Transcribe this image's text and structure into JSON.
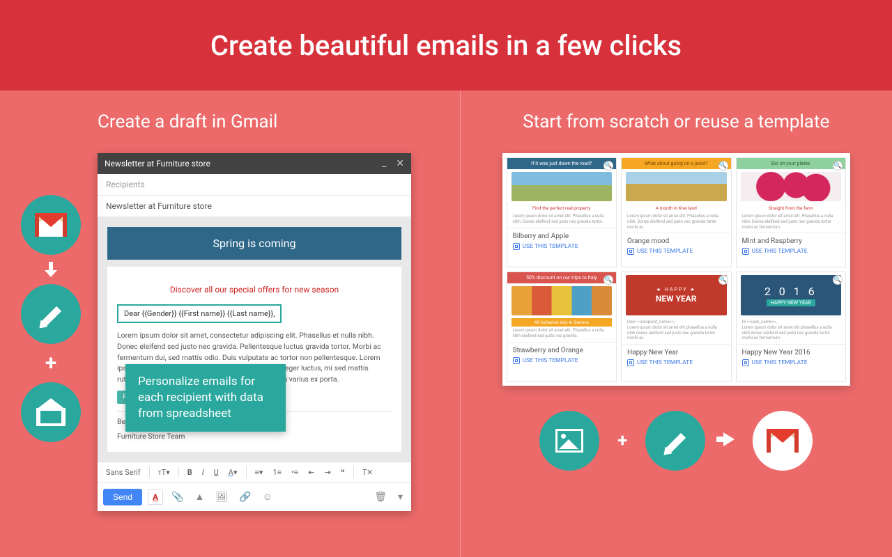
{
  "header": {
    "title": "Create beautiful emails in a few clicks"
  },
  "left_panel": {
    "title": "Create a draft in Gmail",
    "compose": {
      "window_title": "Newsletter at Furniture store",
      "recipients_placeholder": "Recipients",
      "subject": "Newsletter at Furniture store",
      "banner": "Spring is coming",
      "special_line": "Discover all our special offers for new season",
      "greeting": "Dear {{Gender}} {{First name}} {{Last name}},",
      "lorem": "Lorem ipsum dolor sit amet, consectetur adipiscing elit. Phasellus et nulla nibh. Donec eleifend sed justo nec gravida. Pellentesque luctus gravida tortor. Morbi ac fermentum dui, sed mattis odio. Duis vulputate ac tortor non pellentesque. Lorem ipsum dolor sit amet, consectetur adipiscing elit. Integer luctus, mi sed mattis rutrum, risus magna commodo eros et leo iaculis, eu varius ex porta.",
      "read_more": "Read more",
      "sign1": "Best regards,",
      "sign2": "Furniture Store Team",
      "font_label": "Sans Serif",
      "send_label": "Send"
    },
    "callout": "Personalize emails for each recipient with data from spreadsheet"
  },
  "right_panel": {
    "title": "Start from scratch or reuse a template",
    "use_label": "USE THIS TEMPLATE",
    "templates": [
      {
        "banner": "If it was just down the road?",
        "banner_color": "#2f6788",
        "caption": "Find the perfect real property",
        "name": "Bilberry and Apple"
      },
      {
        "banner": "What about going on a jaunt?",
        "banner_color": "#f5a623",
        "caption": "A month in Kiwi land",
        "name": "Orange mood"
      },
      {
        "banner": "Bio on your plates",
        "banner_color": "#8fd19e",
        "caption": "Straight from the farm",
        "name": "Mint and Raspberry"
      },
      {
        "banner": "50% discount on our trips to Italy",
        "banner_color": "#d9534f",
        "caption": "All inclusive stay in Genova",
        "name": "Strawberry and Orange"
      },
      {
        "banner": "",
        "banner_color": "#ffffff",
        "caption": "",
        "name": "Happy New Year"
      },
      {
        "banner": "",
        "banner_color": "#ffffff",
        "caption": "",
        "name": "Happy New Year 2016"
      }
    ]
  }
}
